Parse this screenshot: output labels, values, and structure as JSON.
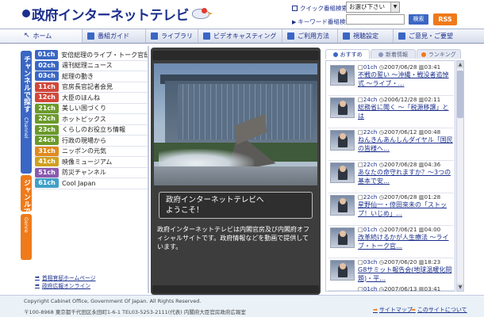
{
  "header": {
    "logo_text": "政府インターネットテレビ",
    "quick_search_label": "クイック番組検索",
    "keyword_search_label": "キーワード番組検索",
    "favorites_select": "お選び下さい",
    "search_button": "検索",
    "rss_button": "RSS"
  },
  "nav": {
    "items": [
      {
        "label": "ホーム"
      },
      {
        "label": "番組ガイド"
      },
      {
        "label": "ライブラリ"
      },
      {
        "label": "ビデオキャスティング"
      },
      {
        "label": "ご利用方法"
      },
      {
        "label": "視聴設定"
      },
      {
        "label": "ご意見・ご要望"
      }
    ]
  },
  "sidebar": {
    "channel_tab_label": "チャンネルで探す",
    "channel_tab_en": "Channel",
    "genre_tab_label": "ジャンルで探す",
    "genre_tab_en": "Genre",
    "channels": [
      {
        "badge": "01ch",
        "name": "安倍総理のライブ・トーク官邸",
        "color": "#3a67c4"
      },
      {
        "badge": "02ch",
        "name": "週刊総理ニュース",
        "color": "#3a67c4"
      },
      {
        "badge": "03ch",
        "name": "総理の動き",
        "color": "#3a67c4"
      },
      {
        "badge": "11ch",
        "name": "官房長官記者会見",
        "color": "#d2473a"
      },
      {
        "badge": "12ch",
        "name": "大臣のほんね",
        "color": "#d2473a"
      },
      {
        "badge": "21ch",
        "name": "美しい国づくり",
        "color": "#6a9a2a"
      },
      {
        "badge": "22ch",
        "name": "ホットピックス",
        "color": "#6a9a2a"
      },
      {
        "badge": "23ch",
        "name": "くらしのお役立ち情報",
        "color": "#6a9a2a"
      },
      {
        "badge": "24ch",
        "name": "行政の現場から",
        "color": "#6a9a2a"
      },
      {
        "badge": "31ch",
        "name": "ニッポンの元気",
        "color": "#e08a1e"
      },
      {
        "badge": "41ch",
        "name": "映像ミュージアム",
        "color": "#d0a020"
      },
      {
        "badge": "51ch",
        "name": "防災チャンネル",
        "color": "#8a5ab0"
      },
      {
        "badge": "61ch",
        "name": "Cool Japan",
        "color": "#3fa0c8"
      }
    ],
    "links": [
      {
        "label": "首相官邸ホームページ"
      },
      {
        "label": "政府広報オンライン"
      }
    ]
  },
  "player": {
    "welcome_line1": "政府インターネットテレビへ",
    "welcome_line2": "ようこそ！",
    "description": "政府インターネットテレビは内閣官房及び内閣府オフィシャルサイトです。政府情報などを動画で提供しています。"
  },
  "right": {
    "tabs": [
      {
        "label": "おすすめ",
        "color": "#3a67c4"
      },
      {
        "label": "新着情報",
        "color": "#8a96b8"
      },
      {
        "label": "ランキング",
        "color": "#ef7a1a"
      }
    ],
    "news": [
      {
        "ch": "01ch",
        "date": "2007/06/28",
        "dur": "03:41",
        "title": "不戦の誓い ～沖縄・戦没者追悼式 ～ライブ・…"
      },
      {
        "ch": "24ch",
        "date": "2006/12/28",
        "dur": "02:11",
        "title": "総務省に聞く ～「税源移譲」とは"
      },
      {
        "ch": "22ch",
        "date": "2007/06/12",
        "dur": "00:48",
        "title": "ねんきんあんしんダイヤル「国民の皆様へ…"
      },
      {
        "ch": "22ch",
        "date": "2007/06/28",
        "dur": "04:36",
        "title": "あなたの命守れますか？～3つの基本で安…"
      },
      {
        "ch": "22ch",
        "date": "2007/06/28",
        "dur": "01:28",
        "title": "星野仙一・倖田來未の「ストップ！いじめ」…"
      },
      {
        "ch": "01ch",
        "date": "2007/06/21",
        "dur": "04:00",
        "title": "改革続けるかが人生療法 ～ライブ・トーク官…"
      },
      {
        "ch": "03ch",
        "date": "2007/06/20",
        "dur": "18:23",
        "title": "G8サミット報告会(地球温暖化問題)・平…"
      },
      {
        "ch": "01ch",
        "date": "2007/06/13",
        "dur": "03:41",
        "title": ""
      }
    ]
  },
  "footer": {
    "copyright": "Copyright Cabinet Office, Government Of Japan. All Rights Reserved.",
    "address": "〒100-8968 東京都千代田区永田町1-6-1 TEL03-5253-2111(代表) 内閣府大臣官房政府広報室",
    "sitemap": "サイトマップ",
    "about": "このサイトについて"
  },
  "colors": {
    "brand": "#1b2f8c",
    "accent": "#3a67c4",
    "rss": "#ef7a1a"
  }
}
